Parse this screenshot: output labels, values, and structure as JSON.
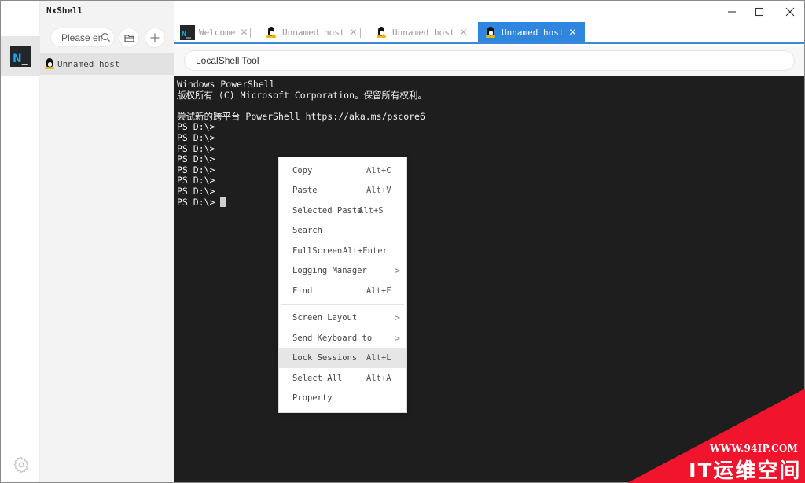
{
  "app": {
    "title": "NxShell",
    "logo_letter": "N",
    "logo_cursor": "_"
  },
  "window_controls": {
    "minimize": "—",
    "maximize": "☐",
    "close": "✕"
  },
  "sidebar": {
    "search_placeholder": "Please en",
    "sessions": [
      {
        "label": "Unnamed host",
        "icon": "linux-icon"
      }
    ]
  },
  "tabs": [
    {
      "label": "Welcome",
      "icon": "nxshell-icon",
      "active": false,
      "close": "✕"
    },
    {
      "label": "Unnamed host",
      "icon": "linux-icon",
      "active": false,
      "close": "✕"
    },
    {
      "label": "Unnamed host",
      "icon": "linux-icon",
      "active": false,
      "close": "✕"
    },
    {
      "label": "Unnamed host",
      "icon": "linux-icon",
      "active": true,
      "close": "✕"
    }
  ],
  "tool": {
    "value": "LocalShell Tool"
  },
  "terminal": {
    "lines": [
      "Windows PowerShell",
      "版权所有 (C) Microsoft Corporation。保留所有权利。",
      "",
      "尝试新的跨平台 PowerShell https://aka.ms/pscore6",
      "PS D:\\>",
      "PS D:\\>",
      "PS D:\\>",
      "PS D:\\>",
      "PS D:\\>",
      "PS D:\\>",
      "PS D:\\>",
      "PS D:\\> "
    ]
  },
  "context_menu": {
    "group1": [
      {
        "label": "Copy",
        "shortcut": "Alt+C",
        "submenu": false
      },
      {
        "label": "Paste",
        "shortcut": "Alt+V",
        "submenu": false
      },
      {
        "label": "Selected Paste",
        "shortcut": "Alt+S",
        "submenu": false
      },
      {
        "label": "Search",
        "shortcut": "",
        "submenu": false
      },
      {
        "label": "FullScreen",
        "shortcut": "Alt+Enter",
        "submenu": false
      },
      {
        "label": "Logging Manager",
        "shortcut": "",
        "submenu": true
      },
      {
        "label": "Find",
        "shortcut": "Alt+F",
        "submenu": false
      }
    ],
    "group2": [
      {
        "label": "Screen Layout",
        "shortcut": "",
        "submenu": true
      },
      {
        "label": "Send Keyboard to",
        "shortcut": "",
        "submenu": true
      },
      {
        "label": "Lock Sessions",
        "shortcut": "Alt+L",
        "submenu": false,
        "highlighted": true
      },
      {
        "label": "Select All",
        "shortcut": "Alt+A",
        "submenu": false
      },
      {
        "label": "Property",
        "shortcut": "",
        "submenu": false
      }
    ],
    "chevron": ">"
  },
  "watermark": {
    "url": "WWW.94IP.COM",
    "title": "IT运维空间"
  },
  "colors": {
    "accent": "#2f86de",
    "terminal_bg": "#1e1e1e",
    "watermark_red": "#f0142d"
  }
}
